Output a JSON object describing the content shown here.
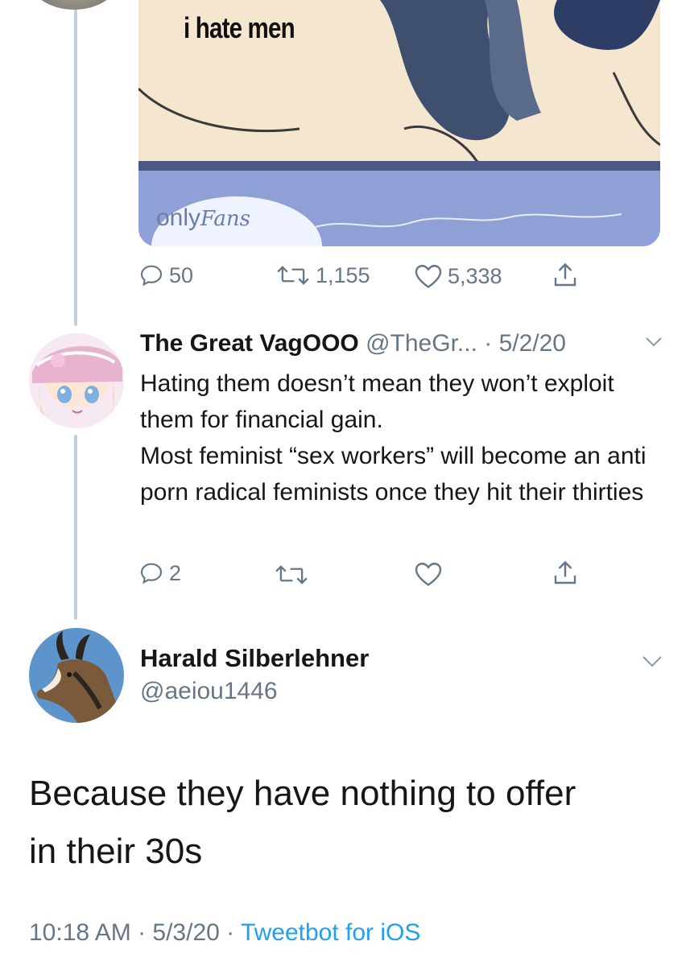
{
  "quoted_media": {
    "caption": "i hate men",
    "logo_text_a": "only",
    "logo_text_b": "Fans"
  },
  "parent_actions": {
    "replies": "50",
    "retweets": "1,155",
    "likes": "5,338"
  },
  "reply": {
    "name": "The Great VagOOO",
    "handle_and_date": "@TheGr... · 5/2/20",
    "body_line1": "Hating them doesn’t mean they won’t exploit them for financial gain.",
    "body_line2": "Most feminist “sex workers” will become an anti porn radical feminists once they hit their thirties",
    "reply_count": "2"
  },
  "tweet": {
    "name": "Harald Silberlehner",
    "handle": "@aeiou1446",
    "text_line1": "Because they have nothing to offer",
    "text_line2": "in their 30s",
    "time_date": "10:18 AM · 5/3/20 · ",
    "client": "Tweetbot for iOS"
  },
  "colors": {
    "link": "#1da1f2",
    "secondary_text": "#657786",
    "thread_line": "#c4cfd6"
  }
}
